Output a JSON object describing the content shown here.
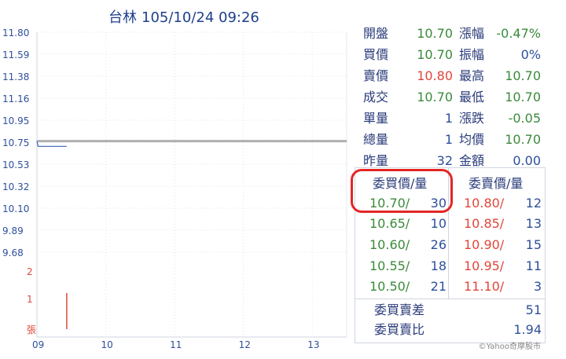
{
  "header": {
    "stock_name": "台林",
    "datetime": "105/10/24 09:26"
  },
  "quote": [
    {
      "label": "開盤",
      "value": "10.70",
      "value_color": "green",
      "label2": "漲幅",
      "value2": "-0.47%",
      "value2_color": "green"
    },
    {
      "label": "買價",
      "value": "10.70",
      "value_color": "green",
      "label2": "振幅",
      "value2": "0%",
      "value2_color": "blue"
    },
    {
      "label": "賣價",
      "value": "10.80",
      "value_color": "red",
      "label2": "最高",
      "value2": "10.70",
      "value2_color": "green"
    },
    {
      "label": "成交",
      "value": "10.70",
      "value_color": "green",
      "label2": "最低",
      "value2": "10.70",
      "value2_color": "green"
    },
    {
      "label": "單量",
      "value": "1",
      "value_color": "blue",
      "label2": "漲跌",
      "value2": "-0.05",
      "value2_color": "green"
    },
    {
      "label": "總量",
      "value": "1",
      "value_color": "blue",
      "label2": "均價",
      "value2": "10.70",
      "value2_color": "green"
    },
    {
      "label": "昨量",
      "value": "32",
      "value_color": "blue",
      "label2": "金額",
      "value2": "0.00",
      "value2_color": "blue"
    }
  ],
  "order_book": {
    "bid_header": "委買價/量",
    "ask_header": "委賣價/量",
    "bids": [
      {
        "price": "10.70/",
        "qty": "30"
      },
      {
        "price": "10.65/",
        "qty": "10"
      },
      {
        "price": "10.60/",
        "qty": "26"
      },
      {
        "price": "10.55/",
        "qty": "18"
      },
      {
        "price": "10.50/",
        "qty": "21"
      }
    ],
    "asks": [
      {
        "price": "10.80/",
        "qty": "12"
      },
      {
        "price": "10.85/",
        "qty": "13"
      },
      {
        "price": "10.90/",
        "qty": "15"
      },
      {
        "price": "10.95/",
        "qty": "11"
      },
      {
        "price": "11.10/",
        "qty": "3"
      }
    ],
    "diff_label": "委買賣差",
    "diff_value": "51",
    "ratio_label": "委買賣比",
    "ratio_value": "1.94"
  },
  "copyright": "©Yahoo奇摩股市",
  "colors": {
    "green": "#3a8a3a",
    "red": "#e0463a",
    "blue": "#2e4f9c",
    "ref_line": "#b0b0b0"
  },
  "chart_data": {
    "type": "line",
    "y_ticks": [
      "11.80",
      "11.59",
      "11.38",
      "11.16",
      "10.95",
      "10.75",
      "10.53",
      "10.32",
      "10.10",
      "9.89",
      "9.68"
    ],
    "volume_ticks": [
      "2",
      "1",
      "張"
    ],
    "x_ticks": [
      "09",
      "10",
      "11",
      "12",
      "13"
    ],
    "ylim": [
      9.68,
      11.8
    ],
    "reference_price": 10.75,
    "price_series": [
      {
        "time": "09:00",
        "price": 10.75
      },
      {
        "time": "09:01",
        "price": 10.7
      },
      {
        "time": "09:26",
        "price": 10.7
      }
    ],
    "volume": [
      {
        "time": "09:26",
        "volume": 1
      }
    ],
    "xlim": [
      "09:00",
      "13:30"
    ]
  }
}
